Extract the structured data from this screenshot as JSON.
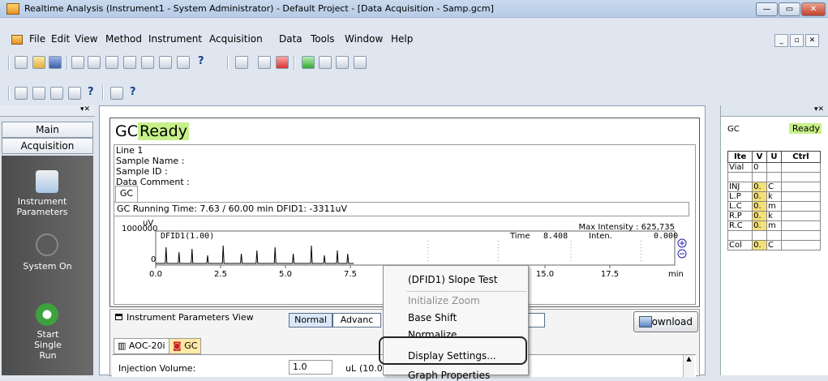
{
  "window": {
    "title": "Realtime Analysis (Instrument1 - System Administrator) - Default Project - [Data Acquisition - Samp.gcm]"
  },
  "menu": [
    "File",
    "Edit",
    "View",
    "Method",
    "Instrument",
    "Acquisition",
    "Data",
    "Tools",
    "Window",
    "Help"
  ],
  "left_panel": {
    "main_label": "Main",
    "acquisition_label": "Acquisition",
    "items": [
      {
        "label": "Instrument Parameters",
        "icon": "instrument-parameters-icon"
      },
      {
        "label": "System On",
        "icon": "power-icon"
      },
      {
        "label": "Start Single Run",
        "icon": "start-run-icon"
      }
    ]
  },
  "gc": {
    "title_prefix": "GC",
    "status": "Ready",
    "line": "Line 1",
    "sample_name": "Sample Name :",
    "sample_id": "Sample ID :",
    "data_comment": "Data Comment :",
    "tab": "GC",
    "running_line": "GC Running Time: 7.63 / 60.00 min DFID1: -3311uV"
  },
  "chart_data": {
    "type": "line",
    "title": "",
    "ylabel": "uV",
    "y_tick": "1000000",
    "y_zero": "0",
    "legend": "DFID1(1.00)",
    "max_intensity": "Max Intensity : 625,735",
    "time_label": "Time",
    "time_value": "8.408",
    "inten_label": "Inten.",
    "inten_value": "0.000",
    "x_ticks": [
      "0.0",
      "2.5",
      "5.0",
      "7.5",
      "15.0",
      "17.5"
    ],
    "x_unit": "min",
    "xlim": [
      0,
      20
    ]
  },
  "ipv": {
    "label": "Instrument Parameters View",
    "normal": "Normal",
    "advanced": "Advanc",
    "download": "Download",
    "tabs": [
      "AOC-20i",
      "GC"
    ],
    "injection_label": "Injection Volume:",
    "injection_value": "1.0",
    "injection_unit": "uL",
    "injection_hint": "(10.0"
  },
  "context_menu": {
    "items": [
      "(DFID1) Slope Test",
      "Initialize Zoom",
      "Base Shift",
      "Normalize",
      "Display Settings...",
      "Graph Properties"
    ]
  },
  "right_panel": {
    "gc": "GC",
    "status": "Ready",
    "headers": [
      "Ite",
      "V",
      "U",
      "Ctrl"
    ],
    "rows": [
      [
        "Vial",
        "0",
        "",
        ""
      ],
      [
        "",
        "",
        "",
        ""
      ],
      [
        "INJ",
        "0.",
        "C",
        ""
      ],
      [
        "L.P",
        "0.",
        "k",
        ""
      ],
      [
        "L.C",
        "0.",
        "m",
        ""
      ],
      [
        "R.P",
        "0.",
        "k",
        ""
      ],
      [
        "R.C",
        "0.",
        "m",
        ""
      ],
      [
        "",
        "",
        "",
        ""
      ],
      [
        "Col",
        "0.",
        "C",
        ""
      ]
    ]
  }
}
